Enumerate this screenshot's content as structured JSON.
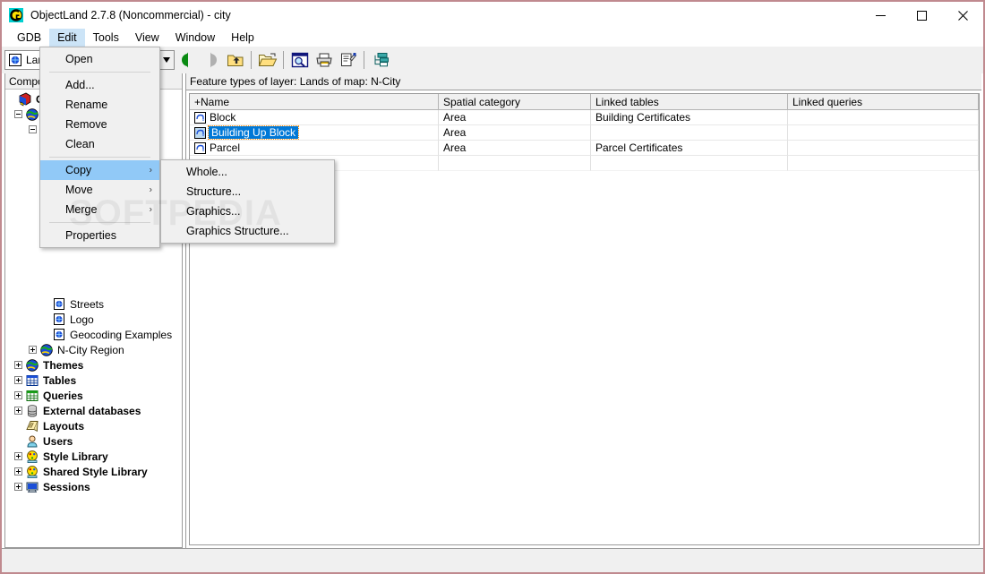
{
  "window": {
    "title": "ObjectLand 2.7.8 (Noncommercial) - city",
    "app_icon": "objectland-logo-icon",
    "minimize_label": "—",
    "maximize_label": "☐",
    "close_label": "✕",
    "border_color": "#c08a8f"
  },
  "menubar": {
    "items": [
      {
        "label": "GDB",
        "active": false
      },
      {
        "label": "Edit",
        "active": true
      },
      {
        "label": "Tools",
        "active": false
      },
      {
        "label": "View",
        "active": false
      },
      {
        "label": "Window",
        "active": false
      },
      {
        "label": "Help",
        "active": false
      }
    ]
  },
  "toolbar": {
    "combo_value": "Lan",
    "combo_icon": "layer-icon",
    "combo_arrow": "▼",
    "buttons": [
      {
        "name": "back-button",
        "icon": "green-back-arrow-icon"
      },
      {
        "name": "forward-button",
        "icon": "gray-forward-arrow-icon"
      },
      {
        "name": "up-level-button",
        "icon": "folder-up-icon"
      },
      {
        "name": "open-button",
        "icon": "open-folder-icon"
      },
      {
        "name": "print-preview-button",
        "icon": "print-preview-icon"
      },
      {
        "name": "print-button",
        "icon": "printer-icon"
      },
      {
        "name": "properties-button",
        "icon": "properties-icon"
      },
      {
        "name": "hierarchy-button",
        "icon": "hierarchy-icon"
      }
    ]
  },
  "tree": {
    "header": "Compor",
    "items": [
      {
        "label": "Co",
        "bold": true,
        "indent": 0,
        "expander": "none",
        "icon": "components-book-icon"
      },
      {
        "label": "",
        "bold": false,
        "indent": 1,
        "expander": "minus",
        "icon": "globe-icon"
      },
      {
        "label": "",
        "bold": false,
        "indent": 2,
        "expander": "minus",
        "icon": ""
      },
      {
        "label": "Streets",
        "bold": false,
        "indent": 3,
        "expander": "none",
        "icon": "layer-icon"
      },
      {
        "label": "Logo",
        "bold": false,
        "indent": 3,
        "expander": "none",
        "icon": "layer-icon"
      },
      {
        "label": "Geocoding Examples",
        "bold": false,
        "indent": 3,
        "expander": "none",
        "icon": "layer-icon"
      },
      {
        "label": "N-City Region",
        "bold": false,
        "indent": 2,
        "expander": "plus",
        "icon": "globe-icon"
      },
      {
        "label": "Themes",
        "bold": true,
        "indent": 1,
        "expander": "plus",
        "icon": "globe-icon"
      },
      {
        "label": "Tables",
        "bold": true,
        "indent": 1,
        "expander": "plus",
        "icon": "table-icon"
      },
      {
        "label": "Queries",
        "bold": true,
        "indent": 1,
        "expander": "plus",
        "icon": "query-icon"
      },
      {
        "label": "External databases",
        "bold": true,
        "indent": 1,
        "expander": "plus",
        "icon": "database-icon"
      },
      {
        "label": "Layouts",
        "bold": true,
        "indent": 1,
        "expander": "none",
        "icon": "layouts-icon"
      },
      {
        "label": "Users",
        "bold": true,
        "indent": 1,
        "expander": "none",
        "icon": "users-icon"
      },
      {
        "label": "Style Library",
        "bold": true,
        "indent": 1,
        "expander": "plus",
        "icon": "style-library-icon"
      },
      {
        "label": "Shared Style Library",
        "bold": true,
        "indent": 1,
        "expander": "plus",
        "icon": "style-library-icon"
      },
      {
        "label": "Sessions",
        "bold": true,
        "indent": 1,
        "expander": "plus",
        "icon": "sessions-icon"
      }
    ]
  },
  "table": {
    "caption": "Feature types of layer: Lands of map: N-City",
    "columns": [
      "+Name",
      "Spatial category",
      "Linked tables",
      "Linked queries"
    ],
    "rows": [
      {
        "name": "Block",
        "category": "Area",
        "linked_tables": "Building Certificates",
        "linked_queries": "",
        "selected": false
      },
      {
        "name": "Building Up Block",
        "category": "Area",
        "linked_tables": "",
        "linked_queries": "",
        "selected": true
      },
      {
        "name": "Parcel",
        "category": "Area",
        "linked_tables": "Parcel Certificates",
        "linked_queries": "",
        "selected": false
      }
    ],
    "row_icon": "feature-type-icon",
    "selection_color": "#0078d7",
    "focus_outline_color": "#ff8c00"
  },
  "edit_menu": {
    "items": [
      {
        "label": "Open",
        "submenu": false,
        "highlighted": false,
        "separator_after": true
      },
      {
        "label": "Add...",
        "submenu": false,
        "highlighted": false,
        "separator_after": false
      },
      {
        "label": "Rename",
        "submenu": false,
        "highlighted": false,
        "separator_after": false
      },
      {
        "label": "Remove",
        "submenu": false,
        "highlighted": false,
        "separator_after": false
      },
      {
        "label": "Clean",
        "submenu": false,
        "highlighted": false,
        "separator_after": true
      },
      {
        "label": "Copy",
        "submenu": true,
        "highlighted": true,
        "separator_after": false
      },
      {
        "label": "Move",
        "submenu": true,
        "highlighted": false,
        "separator_after": false
      },
      {
        "label": "Merge",
        "submenu": true,
        "highlighted": false,
        "separator_after": true
      },
      {
        "label": "Properties",
        "submenu": false,
        "highlighted": false,
        "separator_after": false
      }
    ],
    "submenu_arrow": "›",
    "highlight_color": "#91c9f7"
  },
  "copy_submenu": {
    "items": [
      {
        "label": "Whole..."
      },
      {
        "label": "Structure..."
      },
      {
        "label": "Graphics..."
      },
      {
        "label": "Graphics Structure..."
      }
    ]
  },
  "watermark": {
    "text": "SOFTPEDIA"
  },
  "statusbar": {
    "text": ""
  }
}
